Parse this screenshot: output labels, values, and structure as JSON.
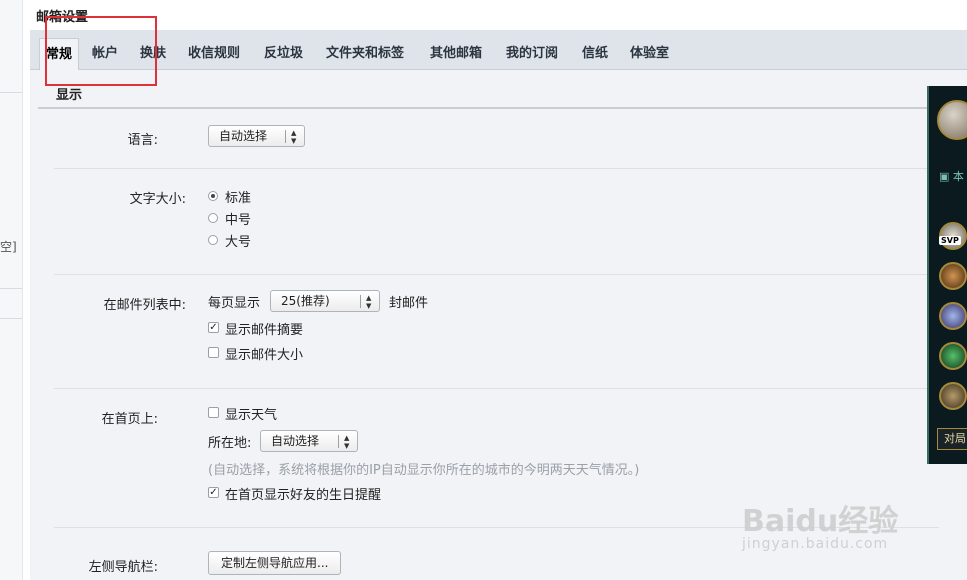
{
  "page": {
    "title": "邮箱设置"
  },
  "tabs": [
    {
      "label": "常规",
      "active": true
    },
    {
      "label": "帐户"
    },
    {
      "label": "换肤"
    },
    {
      "label": "收信规则"
    },
    {
      "label": "反垃圾"
    },
    {
      "label": "文件夹和标签"
    },
    {
      "label": "其他邮箱"
    },
    {
      "label": "我的订阅"
    },
    {
      "label": "信纸"
    },
    {
      "label": "体验室"
    }
  ],
  "left_strip": {
    "fragment": "空]"
  },
  "display_section": {
    "title": "显示",
    "language": {
      "label": "语言:",
      "value": "自动选择"
    },
    "font_size": {
      "label": "文字大小:",
      "options": [
        "标准",
        "中号",
        "大号"
      ],
      "selected": "标准"
    },
    "mail_list": {
      "label": "在邮件列表中:",
      "per_page_prefix": "每页显示",
      "per_page_value": "25(推荐)",
      "per_page_suffix": "封邮件",
      "show_summary": {
        "label": "显示邮件摘要",
        "checked": true
      },
      "show_size": {
        "label": "显示邮件大小",
        "checked": false
      }
    },
    "homepage": {
      "label": "在首页上:",
      "show_weather": {
        "label": "显示天气",
        "checked": false
      },
      "location_label": "所在地:",
      "location_value": "自动选择",
      "weather_note": "(自动选择，系统将根据你的IP自动显示你所在的城市的今明两天天气情况。)",
      "birthday_reminder": {
        "label": "在首页显示好友的生日提醒",
        "checked": true
      }
    },
    "left_nav": {
      "label": "左侧导航栏:",
      "button": "定制左侧导航应用..."
    }
  },
  "game_panel": {
    "caption": "本",
    "button": "对局",
    "badge": "SVP"
  },
  "watermark": {
    "brand": "Baidu经验",
    "url": "jingyan.baidu.com"
  },
  "colors": {
    "highlight_box": "#e0303a",
    "tab_bar": "#dfe4ea",
    "content_bg": "#f1f3f6"
  }
}
